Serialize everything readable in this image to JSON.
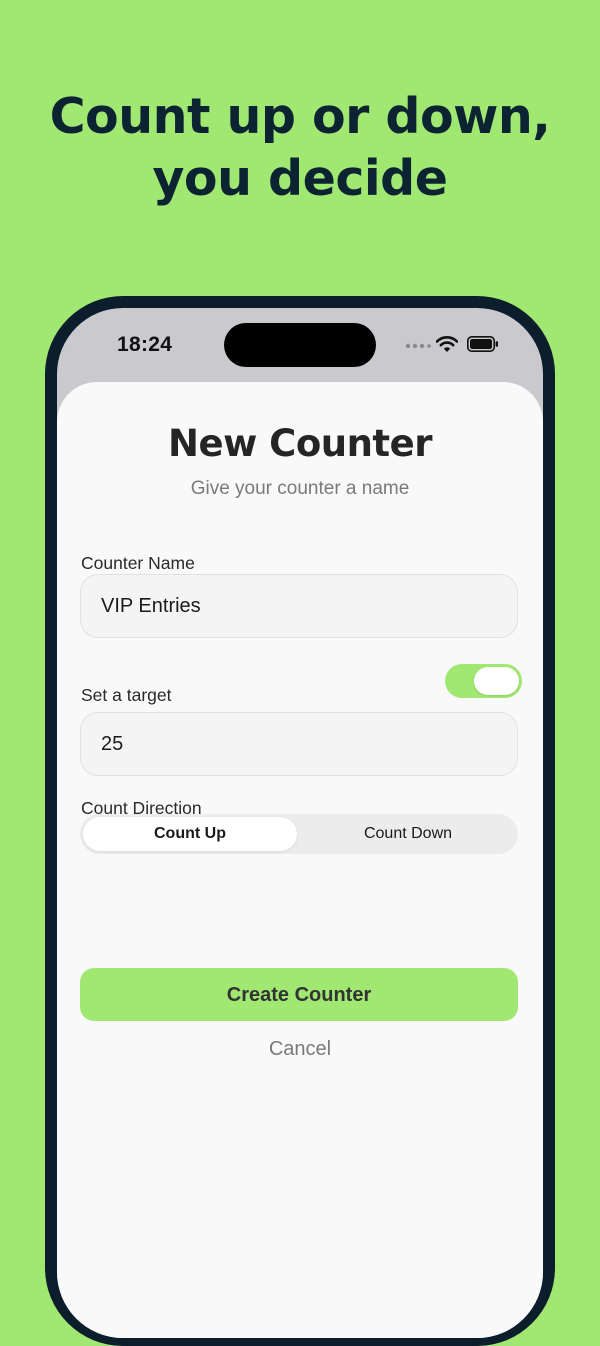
{
  "headline": {
    "line1": "Count up or down,",
    "line2": "you decide"
  },
  "status_bar": {
    "time": "18:24"
  },
  "sheet": {
    "title": "New Counter",
    "subtitle": "Give your counter a name"
  },
  "name_field": {
    "label": "Counter Name",
    "value": "VIP Entries"
  },
  "target": {
    "label": "Set a target",
    "enabled": true,
    "value": "25"
  },
  "direction": {
    "label": "Count Direction",
    "options": [
      "Count Up",
      "Count Down"
    ],
    "selected": "Count Up"
  },
  "actions": {
    "create_label": "Create Counter",
    "cancel_label": "Cancel"
  },
  "colors": {
    "accent": "#a1e873",
    "headline": "#0c2331",
    "phone_frame": "#0c1e2c"
  }
}
